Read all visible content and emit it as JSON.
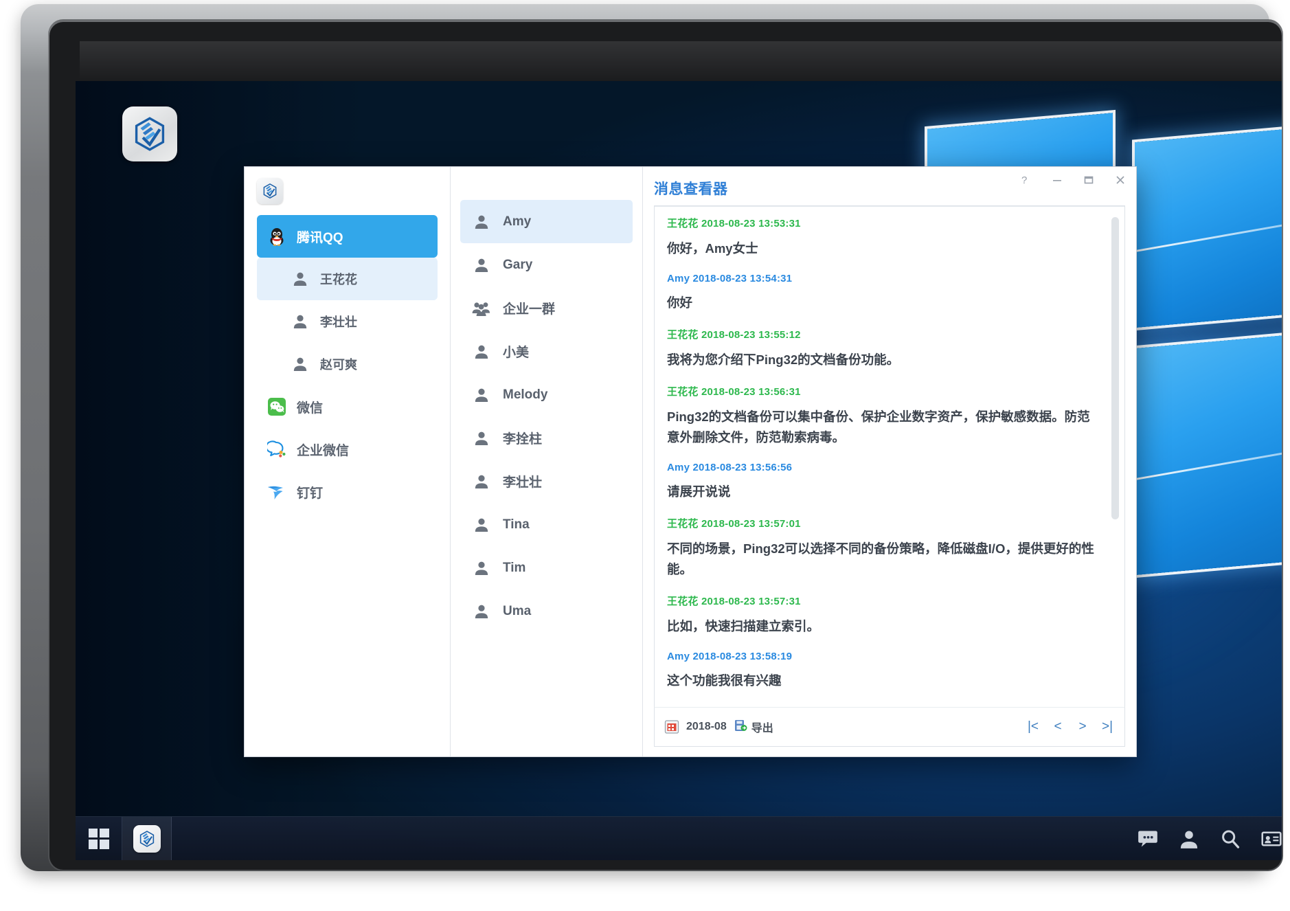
{
  "desktop": {
    "icon_name": "ping32-app-icon"
  },
  "taskbar": {
    "start_label": "Start",
    "pinned_app": "Ping32",
    "tray": [
      {
        "name": "chat-icon",
        "label": "Messages"
      },
      {
        "name": "user-icon",
        "label": "User"
      },
      {
        "name": "search-icon",
        "label": "Search"
      },
      {
        "name": "contact-card-icon",
        "label": "Contacts"
      }
    ]
  },
  "window": {
    "title": "消息查看器",
    "controls": [
      {
        "name": "help-button",
        "glyph": "?"
      },
      {
        "name": "minimize-button",
        "glyph": "–"
      },
      {
        "name": "maximize-button",
        "glyph": "❐"
      },
      {
        "name": "close-button",
        "glyph": "✕"
      }
    ]
  },
  "sidebar": {
    "items": [
      {
        "label": "腾讯QQ",
        "icon": "qq-penguin-icon",
        "type": "app",
        "state": "active"
      },
      {
        "label": "王花花",
        "icon": "person-icon",
        "type": "sub",
        "state": "selected"
      },
      {
        "label": "李壮壮",
        "icon": "person-icon",
        "type": "sub",
        "state": "normal"
      },
      {
        "label": "赵可爽",
        "icon": "person-icon",
        "type": "sub",
        "state": "normal"
      },
      {
        "label": "微信",
        "icon": "wechat-icon",
        "type": "app",
        "state": "normal"
      },
      {
        "label": "企业微信",
        "icon": "wecom-icon",
        "type": "app",
        "state": "normal"
      },
      {
        "label": "钉钉",
        "icon": "dingtalk-icon",
        "type": "app",
        "state": "normal"
      }
    ]
  },
  "contacts": {
    "items": [
      {
        "label": "Amy",
        "icon": "person-icon",
        "state": "selected"
      },
      {
        "label": "Gary",
        "icon": "person-icon",
        "state": "normal"
      },
      {
        "label": "企业一群",
        "icon": "group-icon",
        "state": "normal"
      },
      {
        "label": "小美",
        "icon": "person-icon",
        "state": "normal"
      },
      {
        "label": "Melody",
        "icon": "person-icon",
        "state": "normal"
      },
      {
        "label": "李拴柱",
        "icon": "person-icon",
        "state": "normal"
      },
      {
        "label": "李壮壮",
        "icon": "person-icon",
        "state": "normal"
      },
      {
        "label": "Tina",
        "icon": "person-icon",
        "state": "normal"
      },
      {
        "label": "Tim",
        "icon": "person-icon",
        "state": "normal"
      },
      {
        "label": "Uma",
        "icon": "person-icon",
        "state": "normal"
      }
    ]
  },
  "messages": [
    {
      "sender": "王花花",
      "timestamp": "2018-08-23 13:53:31",
      "side": "left",
      "meta": "王花花 2018-08-23 13:53:31",
      "body": "你好，Amy女士"
    },
    {
      "sender": "Amy",
      "timestamp": "2018-08-23 13:54:31",
      "side": "right",
      "meta": "Amy 2018-08-23 13:54:31",
      "body": "你好"
    },
    {
      "sender": "王花花",
      "timestamp": "2018-08-23 13:55:12",
      "side": "left",
      "meta": "王花花 2018-08-23 13:55:12",
      "body": "我将为您介绍下Ping32的文档备份功能。"
    },
    {
      "sender": "王花花",
      "timestamp": "2018-08-23 13:56:31",
      "side": "left",
      "meta": "王花花 2018-08-23 13:56:31",
      "body": "Ping32的文档备份可以集中备份、保护企业数字资产，保护敏感数据。防范意外删除文件，防范勒索病毒。"
    },
    {
      "sender": "Amy",
      "timestamp": "2018-08-23 13:56:56",
      "side": "right",
      "meta": "Amy 2018-08-23 13:56:56",
      "body": "请展开说说"
    },
    {
      "sender": "王花花",
      "timestamp": "2018-08-23 13:57:01",
      "side": "left",
      "meta": "王花花 2018-08-23 13:57:01",
      "body": "不同的场景，Ping32可以选择不同的备份策略，降低磁盘I/O，提供更好的性能。"
    },
    {
      "sender": "王花花",
      "timestamp": "2018-08-23 13:57:31",
      "side": "left",
      "meta": "王花花 2018-08-23 13:57:31",
      "body": "比如，快速扫描建立索引。"
    },
    {
      "sender": "Amy",
      "timestamp": "2018-08-23 13:58:19",
      "side": "right",
      "meta": "Amy 2018-08-23 13:58:19",
      "body": "这个功能我很有兴趣"
    }
  ],
  "footer": {
    "date": "2018-08",
    "export_label": "导出",
    "pager": [
      {
        "name": "first-page-button",
        "glyph": "|<"
      },
      {
        "name": "prev-page-button",
        "glyph": "<"
      },
      {
        "name": "next-page-button",
        "glyph": ">"
      },
      {
        "name": "last-page-button",
        "glyph": ">|"
      }
    ]
  },
  "colors": {
    "accent": "#32a7ea",
    "title": "#2f7fd6",
    "sender_left": "#2db84d",
    "sender_right": "#2a8ae0",
    "selected_bg": "#e1eefb"
  }
}
